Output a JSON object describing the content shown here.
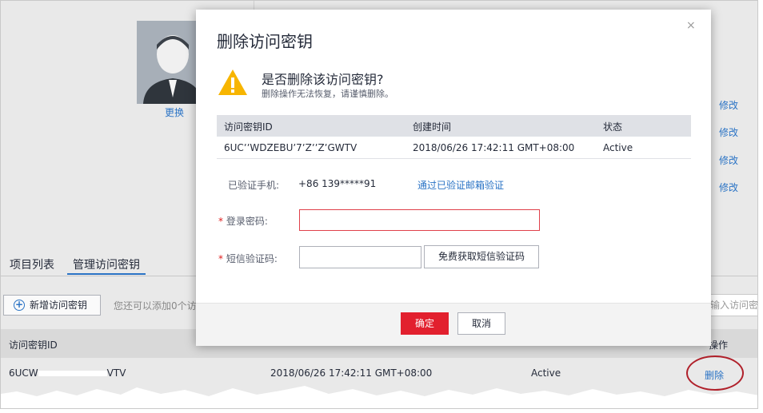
{
  "background": {
    "avatar_change_label": "更换",
    "edit_links": [
      "修改",
      "修改",
      "修改",
      "修改"
    ],
    "tabs": [
      {
        "label": "项目列表"
      },
      {
        "label": "管理访问密钥"
      }
    ],
    "add_key_button": "新增访问密钥",
    "add_key_hint": "您还可以添加0个访",
    "search_placeholder": "输入访问密",
    "table": {
      "headers": [
        "访问密钥ID",
        "操作"
      ],
      "row": {
        "key_id": "6UCW",
        "key_id_suffix": "VTV",
        "created": "2018/06/26 17:42:11 GMT+08:00",
        "status": "Active",
        "action": "删除"
      }
    }
  },
  "dialog": {
    "title": "删除访问密钥",
    "close_icon": "×",
    "warning_title": "是否删除该访问密钥?",
    "warning_subtitle": "删除操作无法恢复，请谨慎删除。",
    "table": {
      "headers": [
        "访问密钥ID",
        "创建时间",
        "状态"
      ],
      "row": {
        "key_id": "6UCʼʼWDZEBUʼ7ʼZʼʼZʼGWTV",
        "created": "2018/06/26 17:42:11 GMT+08:00",
        "status": "Active"
      }
    },
    "verified_phone_label": "已验证手机:",
    "verified_phone_value": "+86 139*****91",
    "email_verify_link": "通过已验证邮箱验证",
    "password_label": "登录密码:",
    "sms_label": "短信验证码:",
    "required_mark": "*",
    "sms_button": "免费获取短信验证码",
    "ok_button": "确定",
    "cancel_button": "取消"
  },
  "colors": {
    "primary_blue": "#2a73c5",
    "danger_red": "#e2202e",
    "warning_yellow": "#f7b500"
  }
}
